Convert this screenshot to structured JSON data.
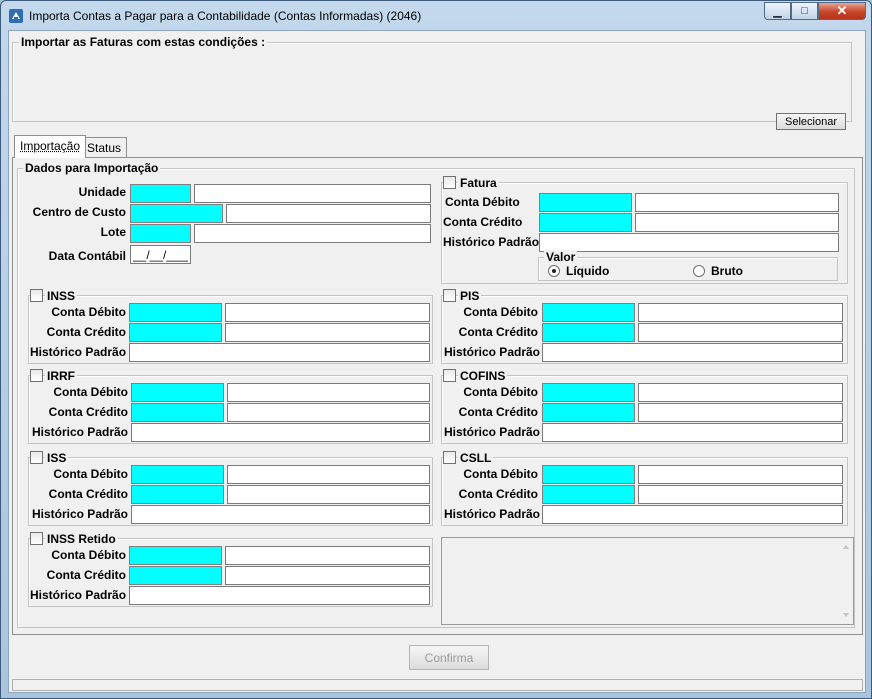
{
  "window": {
    "title": "Importa Contas a Pagar para a Contabilidade (Contas Informadas) (2046)",
    "min_glyph": "▁",
    "max_glyph": "□",
    "close_glyph": "✕"
  },
  "conditions": {
    "legend": "Importar as Faturas com estas condições :",
    "select_label": "Selecionar"
  },
  "tabs": [
    "Importação",
    "Status"
  ],
  "dados": {
    "legend": "Dados para Importação",
    "unidade_label": "Unidade",
    "centro_label": "Centro de Custo",
    "lote_label": "Lote",
    "data_label": "Data Contábil",
    "data_value": "__/__/____"
  },
  "labels": {
    "debito": "Conta Débito",
    "credito": "Conta Crédito",
    "historico": "Histórico Padrão"
  },
  "groups": {
    "fatura": "Fatura",
    "inss": "INSS",
    "pis": "PIS",
    "irrf": "IRRF",
    "cofins": "COFINS",
    "iss": "ISS",
    "csll": "CSLL",
    "inss_retido": "INSS Retido"
  },
  "valor": {
    "legend": "Valor",
    "liquido": "Líquido",
    "bruto": "Bruto"
  },
  "confirm_label": "Confirma",
  "colors": {
    "cyan_field": "#00ffff",
    "titlebar": "#c3d8ec"
  }
}
